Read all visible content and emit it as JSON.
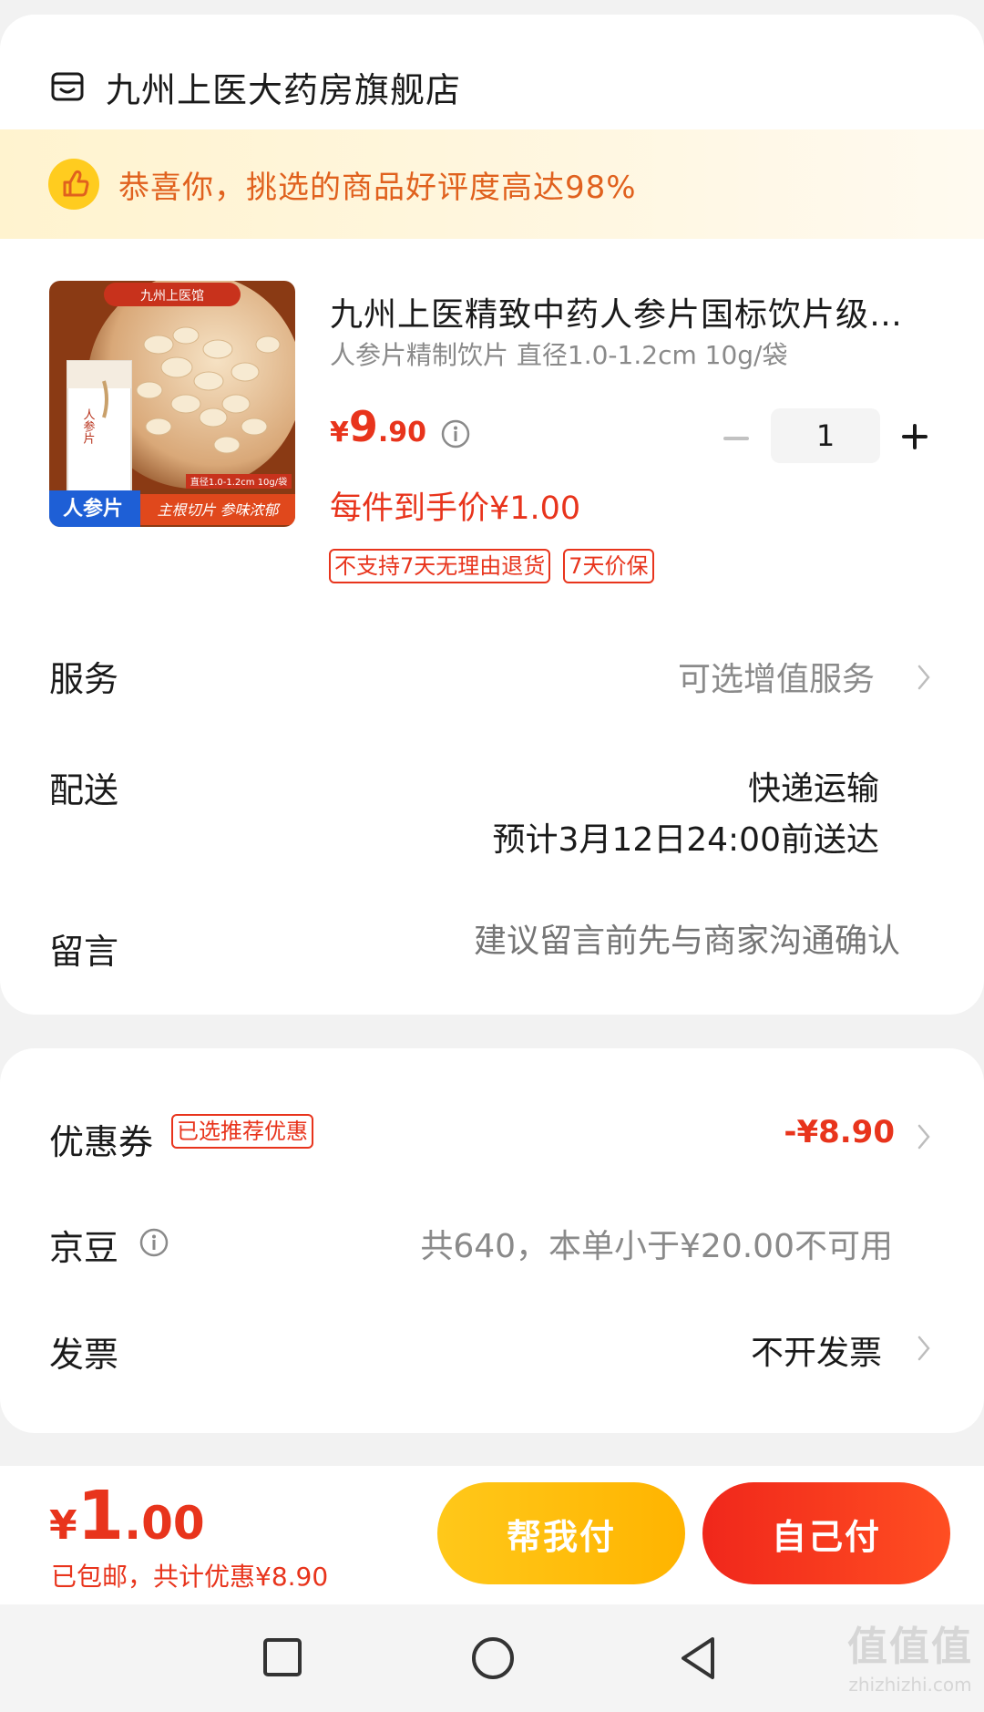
{
  "store": {
    "name": "九州上医大药房旗舰店",
    "icon": "store-icon"
  },
  "banner": {
    "text": "恭喜你，挑选的商品好评度高达98%",
    "icon": "thumbs-up-icon"
  },
  "product": {
    "title": "九州上医精致中药人参片国标饮片级…",
    "spec": "人参片精制饮片 直径1.0-1.2cm 10g/袋",
    "image": {
      "brand": "九州上医馆",
      "bag_label": "人参片",
      "badge": "人参片",
      "tagline": "主根切片 参味浓郁",
      "size_note": "直径1.0-1.2cm 10g/袋"
    },
    "price_currency": "¥",
    "price_int": "9",
    "price_dec": ".90",
    "unit_price": "每件到手价¥1.00",
    "quantity": "1",
    "tags": [
      "不支持7天无理由退货",
      "7天价保"
    ]
  },
  "service": {
    "label": "服务",
    "value": "可选增值服务"
  },
  "delivery": {
    "label": "配送",
    "method": "快递运输",
    "eta": "预计3月12日24:00前送达"
  },
  "message": {
    "label": "留言",
    "placeholder": "建议留言前先与商家沟通确认"
  },
  "coupon": {
    "label": "优惠券",
    "tag": "已选推荐优惠",
    "value": "-¥8.90"
  },
  "beans": {
    "label": "京豆",
    "value": "共640，本单小于¥20.00不可用"
  },
  "invoice": {
    "label": "发票",
    "value": "不开发票"
  },
  "footer": {
    "currency": "¥",
    "total_int": "1",
    "total_dec": ".00",
    "summary": "已包邮，共计优惠¥8.90",
    "help_pay": "帮我付",
    "self_pay": "自己付"
  },
  "watermark": {
    "big": "值值值",
    "small": "zhizhizhi.com"
  },
  "colors": {
    "accent": "#e8341c",
    "yellow": "#ffc81a",
    "banner_text": "#e0611e"
  }
}
